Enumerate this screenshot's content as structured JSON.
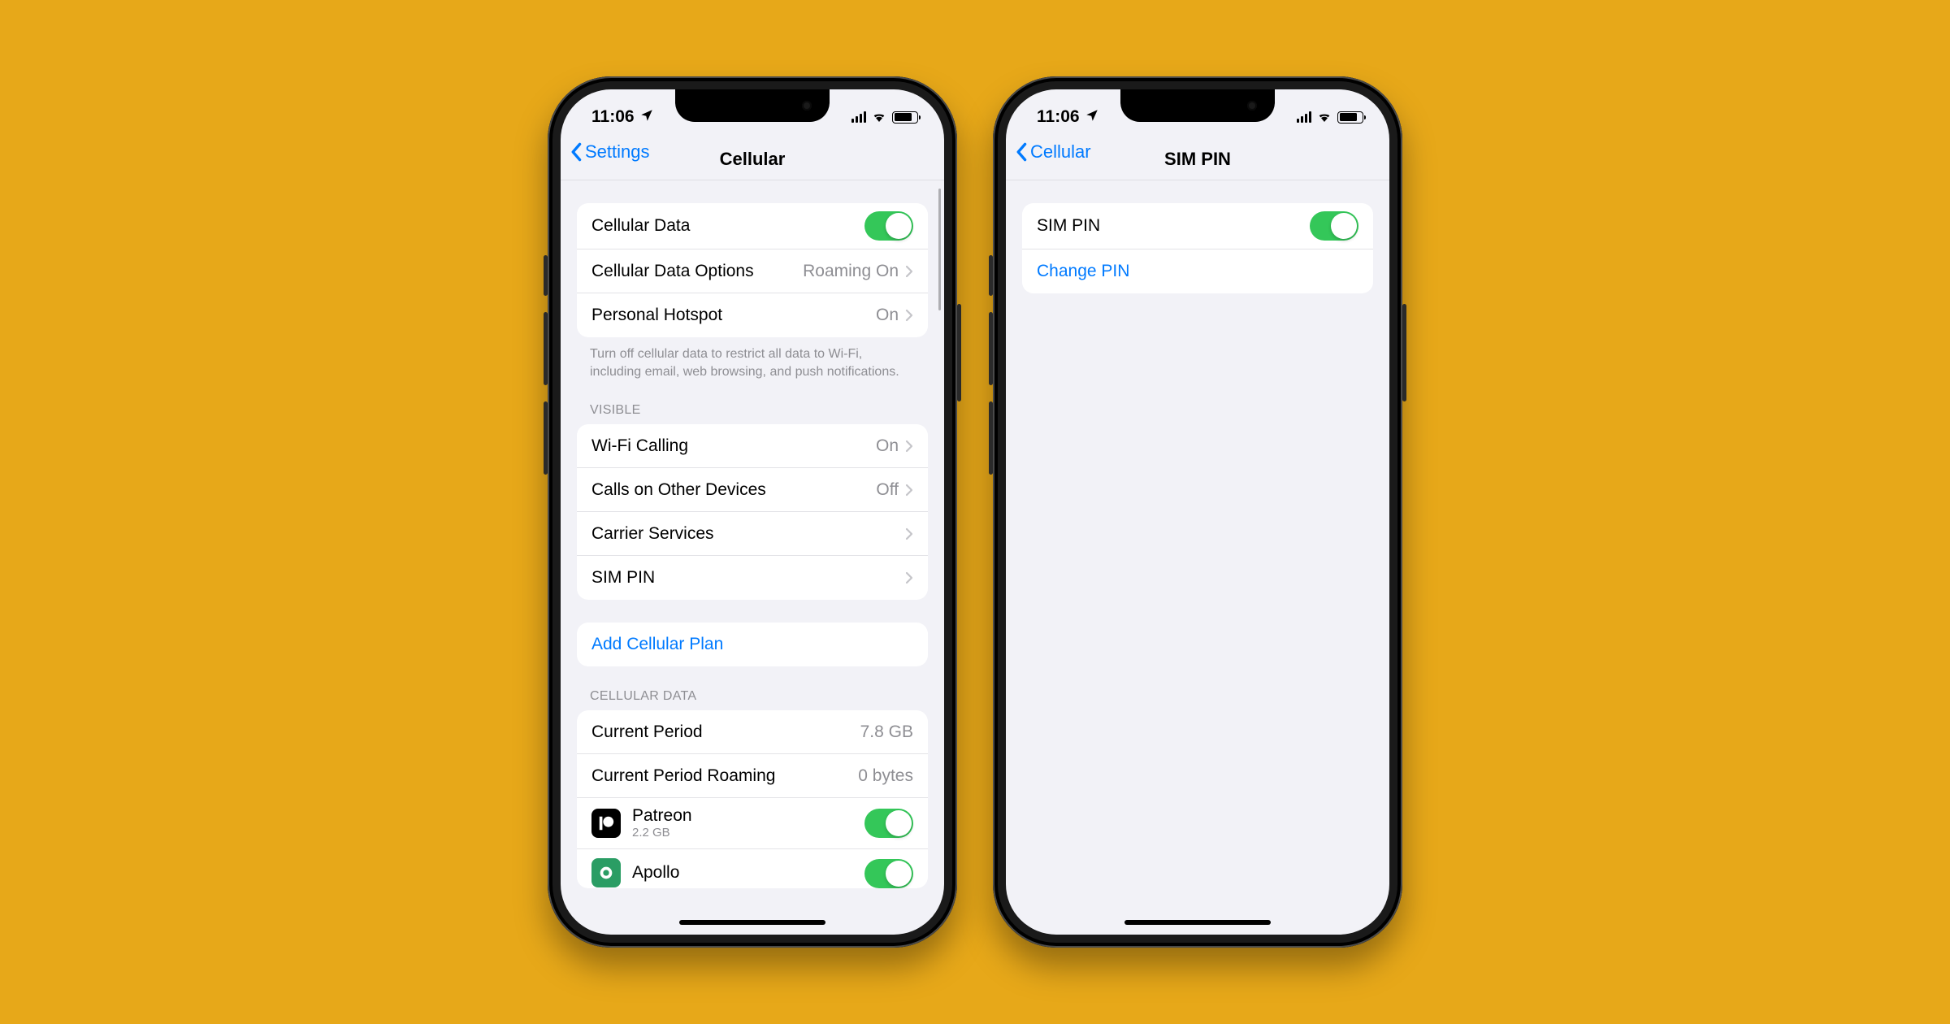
{
  "status": {
    "time": "11:06"
  },
  "left": {
    "back": "Settings",
    "title": "Cellular",
    "group1": {
      "cellular_data": "Cellular Data",
      "cellular_data_options": {
        "label": "Cellular Data Options",
        "value": "Roaming On"
      },
      "personal_hotspot": {
        "label": "Personal Hotspot",
        "value": "On"
      },
      "footer": "Turn off cellular data to restrict all data to Wi-Fi, including email, web browsing, and push notifications."
    },
    "visible_header": "Visible",
    "group2": {
      "wifi_calling": {
        "label": "Wi-Fi Calling",
        "value": "On"
      },
      "calls_other": {
        "label": "Calls on Other Devices",
        "value": "Off"
      },
      "carrier_services": "Carrier Services",
      "sim_pin": "SIM PIN"
    },
    "add_plan": "Add Cellular Plan",
    "data_header": "Cellular Data",
    "group4": {
      "current_period": {
        "label": "Current Period",
        "value": "7.8 GB"
      },
      "current_roaming": {
        "label": "Current Period Roaming",
        "value": "0 bytes"
      },
      "apps": [
        {
          "name": "Patreon",
          "sub": "2.2 GB"
        },
        {
          "name": "Apollo",
          "sub": ""
        }
      ]
    }
  },
  "right": {
    "back": "Cellular",
    "title": "SIM PIN",
    "sim_pin": "SIM PIN",
    "change_pin": "Change PIN"
  }
}
